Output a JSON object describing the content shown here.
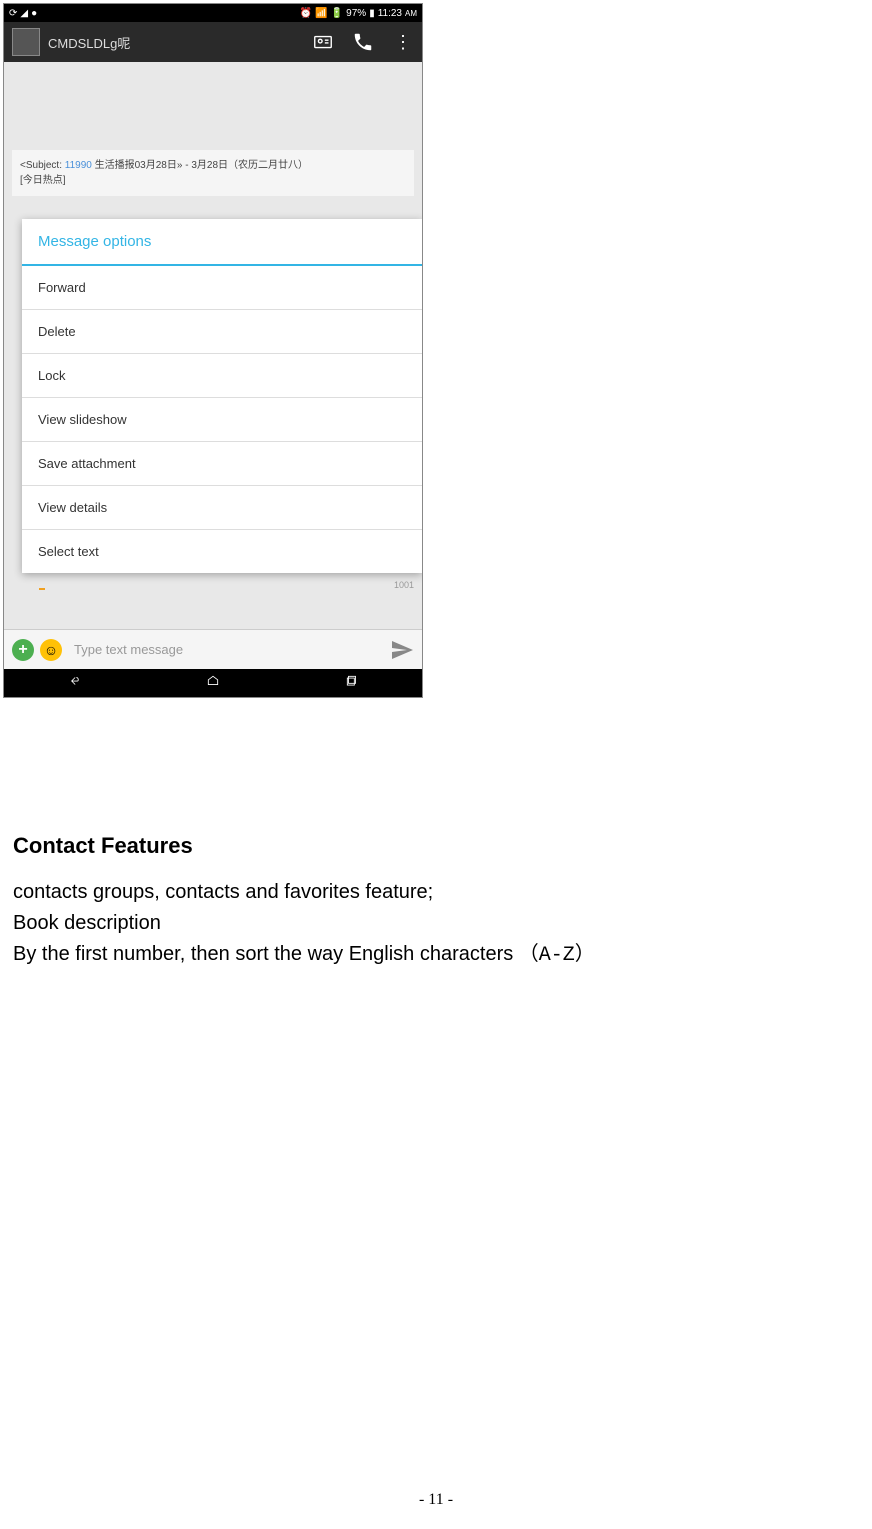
{
  "status_bar": {
    "battery_pct": "97%",
    "time": "11:23",
    "time_suffix": "AM"
  },
  "app_header": {
    "contact_name": "CMDSLDLg呢"
  },
  "message": {
    "subject_prefix": "<Subject:",
    "subject_link": "11990",
    "subject_text": "生活播报03月28日» - 3月28日（农历二月廿八）",
    "hot_today": "[今日热点]"
  },
  "dialog": {
    "title": "Message options",
    "items": [
      "Forward",
      "Delete",
      "Lock",
      "View slideshow",
      "Save attachment",
      "View details",
      "Select text"
    ]
  },
  "input": {
    "placeholder": "Type text message"
  },
  "page_indicator": "1001",
  "doc": {
    "heading": "Contact Features",
    "line1": "contacts groups, contacts and favorites feature;",
    "line2": "Book description",
    "line3_prefix": "By the first number, then sort the way English characters ",
    "line3_suffix": "（A-Z）"
  },
  "page_number": "- 11 -"
}
